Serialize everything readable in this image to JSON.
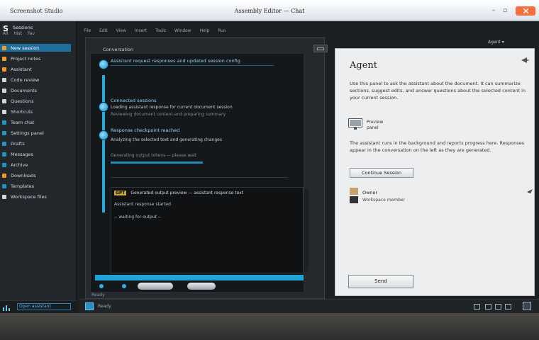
{
  "window": {
    "app_title": "Screenshot Studio",
    "doc_title": "Assembly Editor — Chat"
  },
  "sidebar": {
    "header": "Sessions",
    "tabs": [
      "All",
      "Hist",
      "Fav"
    ],
    "items": [
      {
        "label": "New session",
        "color": "#f39a2a",
        "active": true
      },
      {
        "label": "Project notes",
        "color": "#f39a2a"
      },
      {
        "label": "Assistant",
        "color": "#f39a2a"
      },
      {
        "label": "Code review",
        "color": "#cfd6dc"
      },
      {
        "label": "Documents",
        "color": "#cfd6dc"
      },
      {
        "label": "Questions",
        "color": "#cfd6dc"
      },
      {
        "label": "Shortcuts",
        "color": "#cfd6dc"
      },
      {
        "label": "Team chat",
        "color": "#2a8fc2"
      },
      {
        "label": "Settings panel",
        "color": "#2a8fc2"
      },
      {
        "label": "Drafts",
        "color": "#2a8fc2"
      },
      {
        "label": "Messages",
        "color": "#2a8fc2"
      },
      {
        "label": "Archive",
        "color": "#2a8fc2"
      },
      {
        "label": "Downloads",
        "color": "#f39a2a"
      },
      {
        "label": "Templates",
        "color": "#2a8fc2"
      },
      {
        "label": "Workspace files",
        "color": "#cfd6dc"
      }
    ],
    "footer_link": "Open assistant"
  },
  "toolbar": {
    "items": [
      "File",
      "Edit",
      "View",
      "Insert",
      "Tools",
      "Window",
      "Help",
      "Run"
    ]
  },
  "chat": {
    "header": "Conversation",
    "messages": [
      {
        "sender": "Assistant  request  responses  and  updated  session  config",
        "lines": []
      },
      {
        "sender": "Connected  sessions",
        "lines": [
          "Loading  assistant  response  for  current  document  session",
          "Reviewing  document  content  and  preparing  summary"
        ]
      },
      {
        "sender": "Response  checkpoint  reached",
        "lines": [
          "Analyzing  the  selected  text  and  generating  changes",
          "Generating  output  tokens  —  please  wait"
        ]
      }
    ],
    "code_header_tag": "GPT",
    "code_header": "Generated  output  preview  — assistant  response  text",
    "code_lines": [
      "Assistant  response  started",
      "-- waiting for output --"
    ],
    "footer": "Ready"
  },
  "agent": {
    "top_label": "Agent ▾",
    "title": "Agent",
    "intro": "Use this panel to ask the assistant about the document. It can summarize sections, suggest edits, and answer questions about the selected content in your current session.",
    "thumb_caption_1": "Preview",
    "thumb_caption_2": "panel",
    "detail": "The assistant runs in the background and reports progress here. Responses appear in the conversation on the left as they are generated.",
    "button_primary": "Continue Session",
    "user_name": "Owner",
    "user_subtitle": "Workspace  member",
    "button_bottom": "Send"
  },
  "status": {
    "label": "Ready"
  }
}
